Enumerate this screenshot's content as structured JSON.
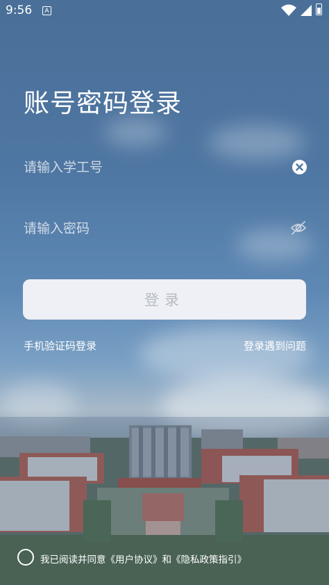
{
  "status": {
    "time": "9:56",
    "notification_letter": "A"
  },
  "title": "账号密码登录",
  "student_id": {
    "placeholder": "请输入学工号"
  },
  "password": {
    "placeholder": "请输入密码"
  },
  "login_button": "登录",
  "sms_login": "手机验证码登录",
  "login_problem": "登录遇到问题",
  "agreement": {
    "prefix": "我已阅读并同意",
    "user_agreement": "《用户协议》",
    "and": "和",
    "privacy": "《隐私政策指引》"
  },
  "colors": {
    "sky": "#4f77a3",
    "button": "#eef0f5",
    "button_text": "#b7bbc3"
  }
}
